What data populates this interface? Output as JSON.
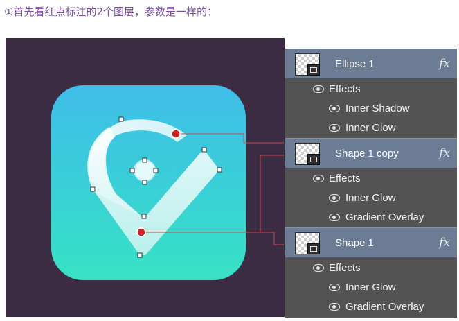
{
  "caption": "①首先看红点标注的2个图层，参数是一样的：",
  "colors": {
    "caption": "#7a4fa3",
    "canvas_bg": "#3b2c43",
    "tile_top": "#3fbde9",
    "tile_bottom": "#38e2c4",
    "panel_bg": "#535353",
    "layer_row_bg": "#6b7c94",
    "marker_red": "#d42020",
    "connector_line": "#c8484b"
  },
  "layers_panel": {
    "layers": [
      {
        "name": "Ellipse 1",
        "fx_label": "fx",
        "thumb_icon": "transparency-thumbnail-icon",
        "effects_label": "Effects",
        "effects": [
          "Inner Shadow",
          "Inner Glow"
        ]
      },
      {
        "name": "Shape 1 copy",
        "fx_label": "fx",
        "thumb_icon": "transparency-thumbnail-icon",
        "effects_label": "Effects",
        "effects": [
          "Inner Glow",
          "Gradient Overlay"
        ]
      },
      {
        "name": "Shape 1",
        "fx_label": "fx",
        "thumb_icon": "transparency-thumbnail-icon",
        "effects_label": "Effects",
        "effects": [
          "Inner Glow",
          "Gradient Overlay"
        ]
      }
    ]
  }
}
